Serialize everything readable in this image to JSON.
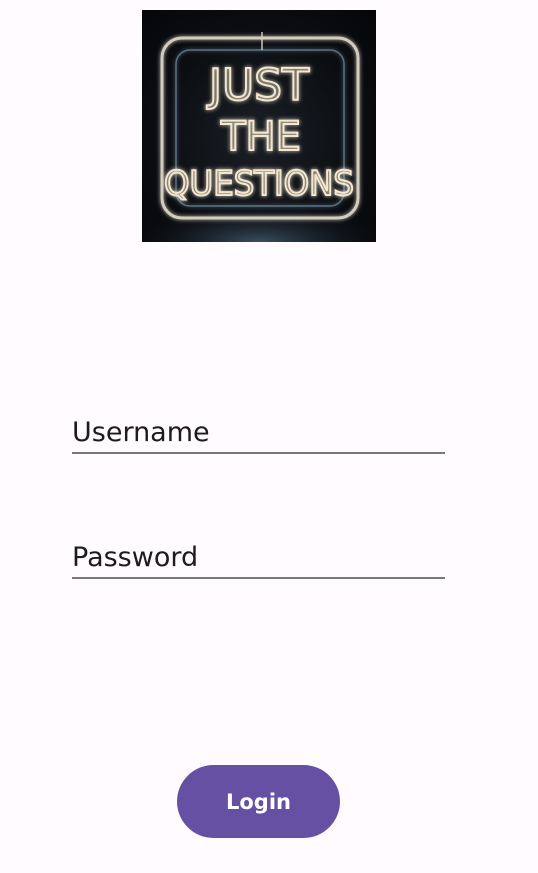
{
  "logo": {
    "line1": "JUST",
    "line2": "THE",
    "line3": "QUESTIONS",
    "colors": {
      "background": "#0b0d11",
      "neon": "#f3e7cf",
      "glow": "#8fc2e6"
    }
  },
  "form": {
    "username_placeholder": "Username",
    "password_placeholder": "Password",
    "login_label": "Login"
  },
  "theme": {
    "page_background": "#fffbfe",
    "accent": "#6650a4",
    "underline": "#7a7680"
  }
}
